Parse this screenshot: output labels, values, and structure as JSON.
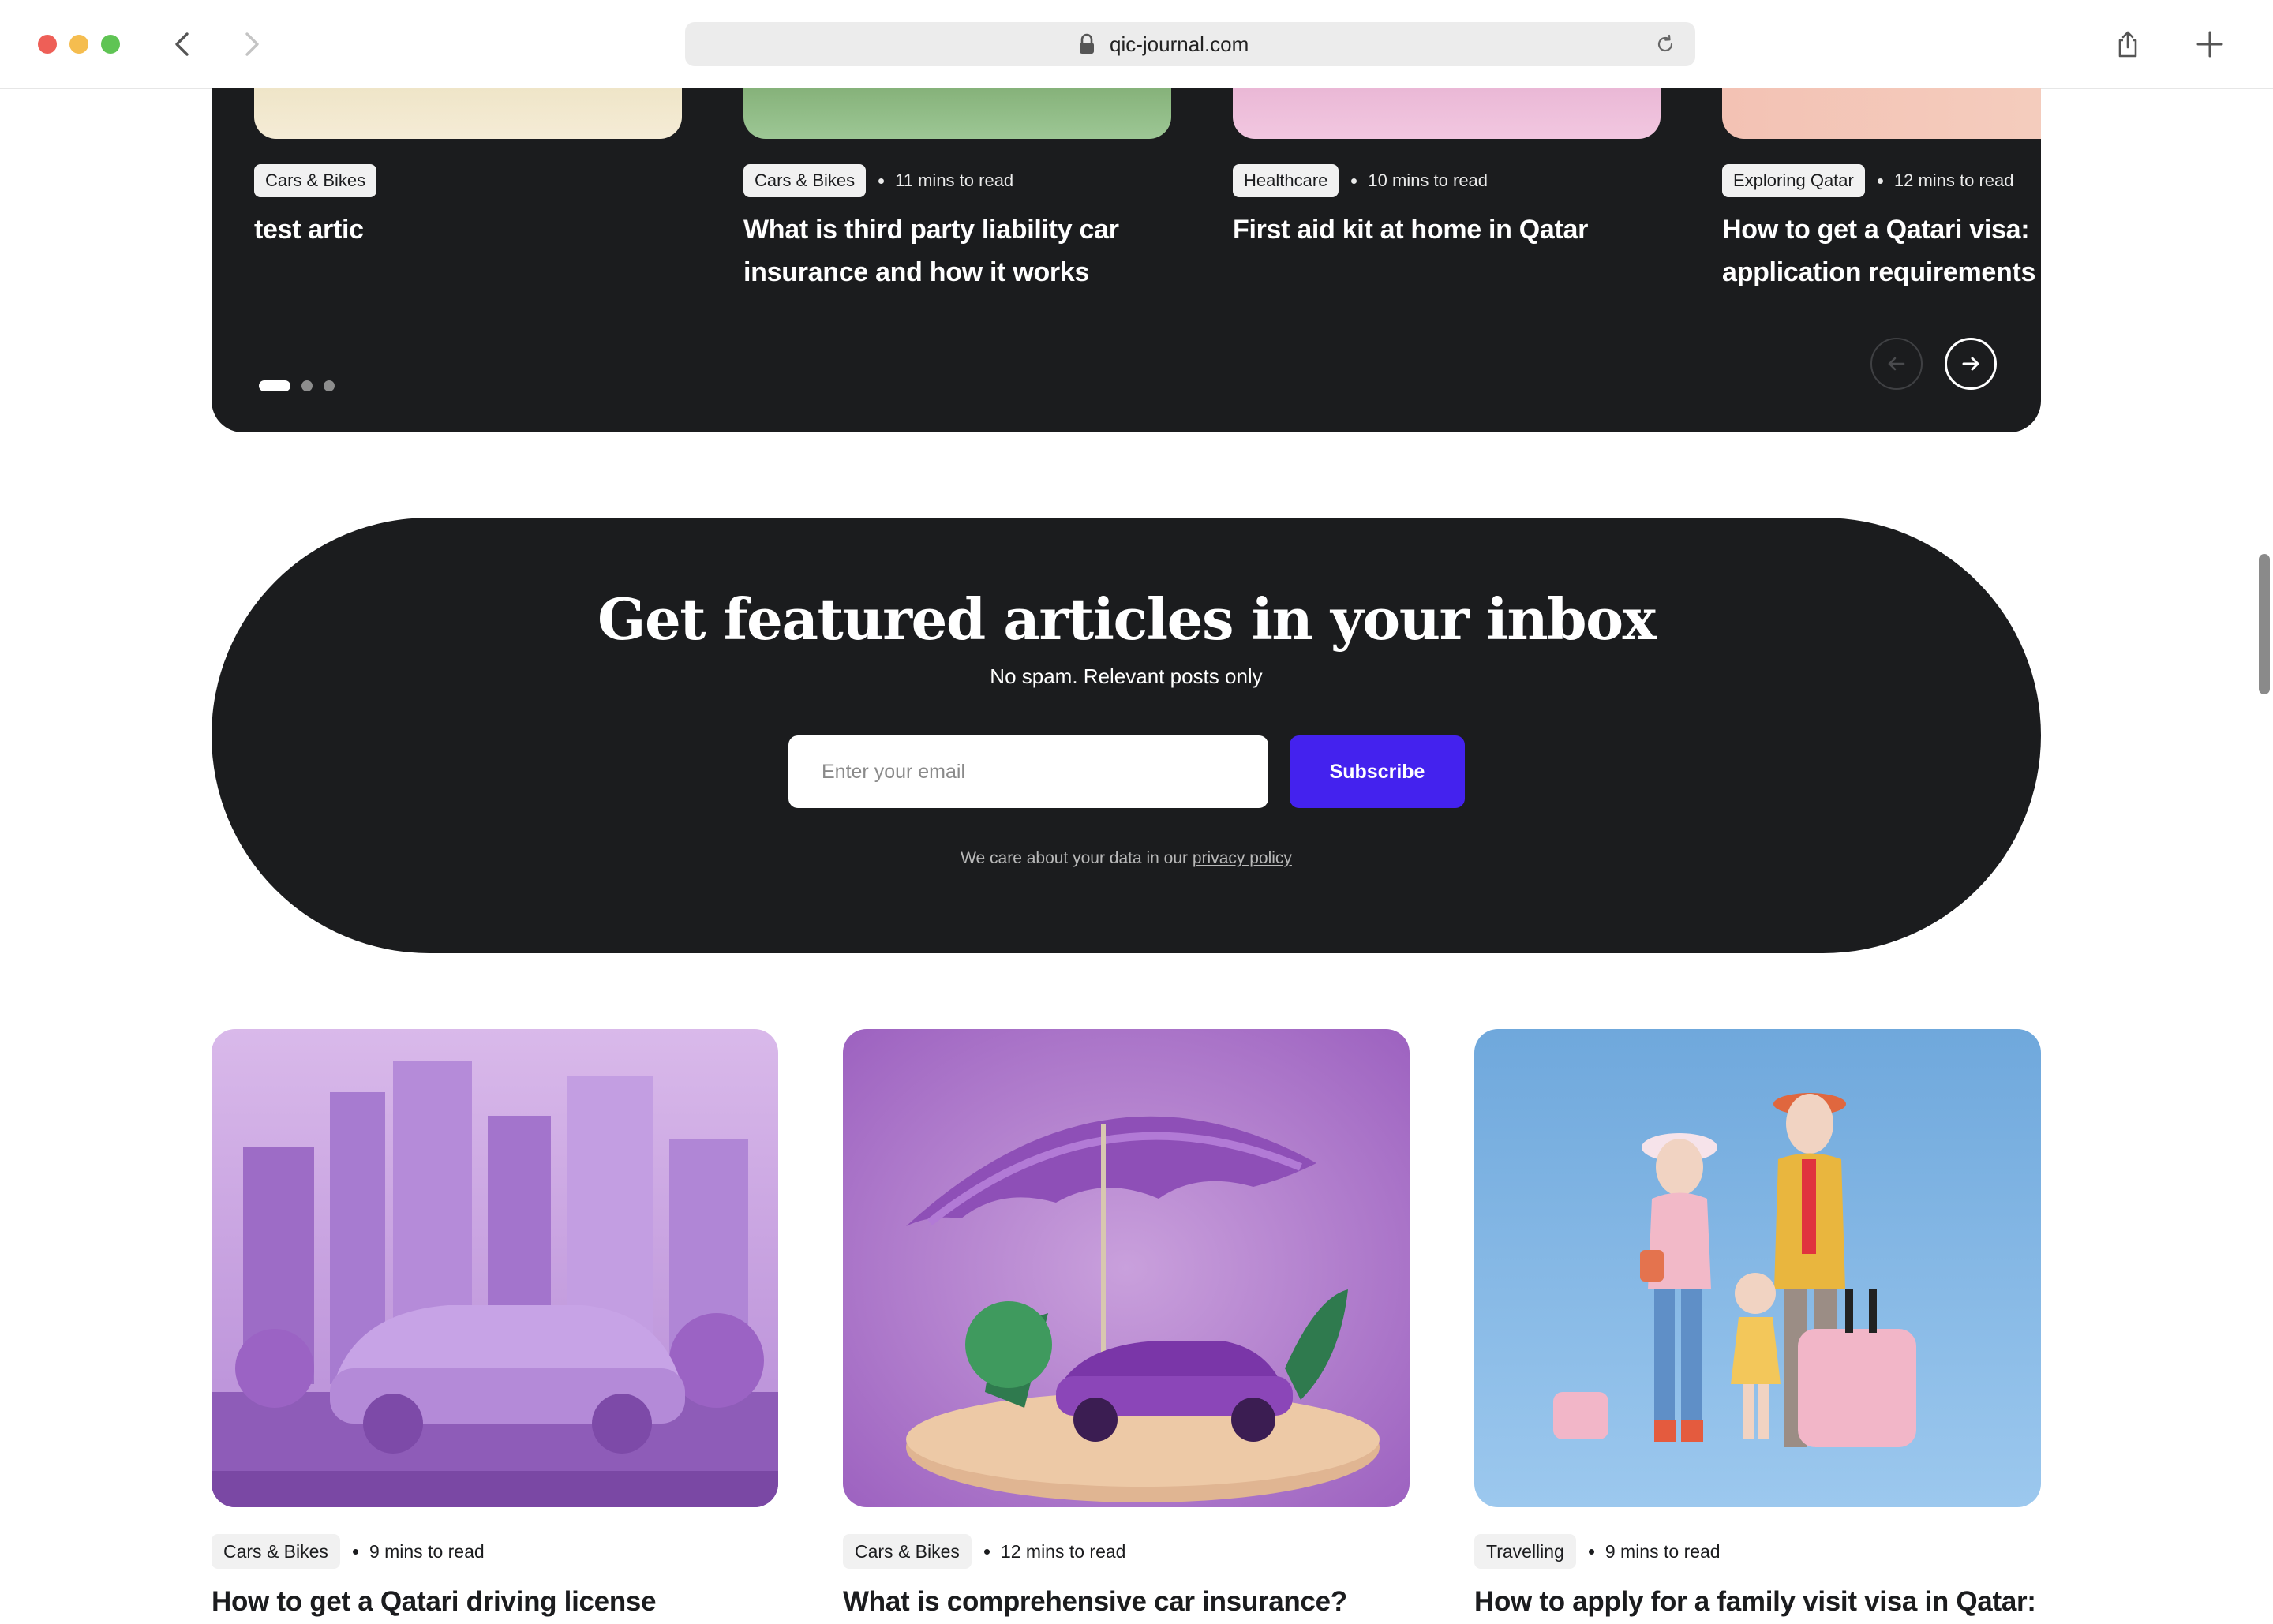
{
  "browser": {
    "url": "qic-journal.com"
  },
  "carousel": {
    "slides": [
      {
        "tag": "Cars & Bikes",
        "read_time": "",
        "title": "test artic"
      },
      {
        "tag": "Cars & Bikes",
        "read_time": "11 mins to read",
        "title": "What is third party liability car insurance and how it works"
      },
      {
        "tag": "Healthcare",
        "read_time": "10 mins to read",
        "title": "First aid kit at home in Qatar"
      },
      {
        "tag": "Exploring Qatar",
        "read_time": "12 mins to read",
        "title": "How to get a Qatari visa: application requirements"
      }
    ],
    "pagination": {
      "pages": 3,
      "active_page": 1
    }
  },
  "newsletter": {
    "title": "Get featured articles in your inbox",
    "subtitle": "No spam. Relevant posts only",
    "email_placeholder": "Enter your email",
    "subscribe_label": "Subscribe",
    "privacy_prefix": "We care about your data in our",
    "privacy_link": "privacy policy",
    "accent_color": "#4422ee"
  },
  "articles": [
    {
      "tag": "Cars & Bikes",
      "read_time": "9 mins to read",
      "title": "How to get a Qatari driving license"
    },
    {
      "tag": "Cars & Bikes",
      "read_time": "12 mins to read",
      "title": "What is comprehensive car insurance?"
    },
    {
      "tag": "Travelling",
      "read_time": "9 mins to read",
      "title": "How to apply for a family visit visa in Qatar:"
    }
  ]
}
